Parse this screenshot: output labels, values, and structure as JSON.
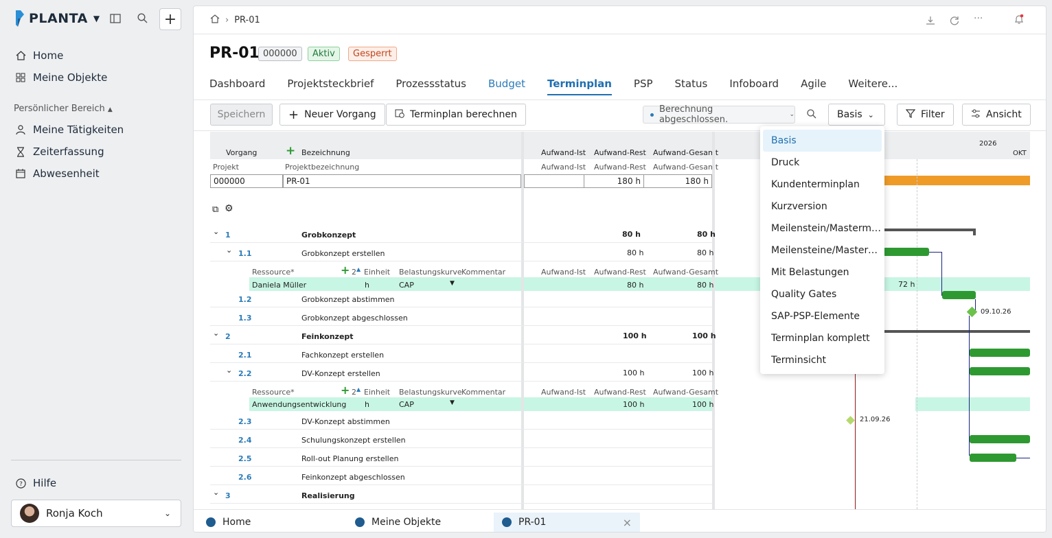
{
  "sidebar": {
    "logo": "PLANTA",
    "nav": [
      {
        "label": "Home",
        "icon": "home-icon"
      },
      {
        "label": "Meine Objekte",
        "icon": "grid-icon"
      }
    ],
    "section_title": "Persönlicher Bereich",
    "personal": [
      {
        "label": "Meine Tätigkeiten",
        "icon": "person-icon"
      },
      {
        "label": "Zeiterfassung",
        "icon": "hourglass-icon"
      },
      {
        "label": "Abwesenheit",
        "icon": "calendar-icon"
      }
    ],
    "help": "Hilfe",
    "user": "Ronja Koch"
  },
  "breadcrumb": "PR-01",
  "project": {
    "title": "PR-01",
    "id_badge": "000000",
    "status_active": "Aktiv",
    "status_locked": "Gesperrt"
  },
  "tabs": [
    "Dashboard",
    "Projektsteckbrief",
    "Prozessstatus",
    "Budget",
    "Terminplan",
    "PSP",
    "Status",
    "Infoboard",
    "Agile",
    "Weitere..."
  ],
  "toolbar": {
    "save": "Speichern",
    "new_task": "Neuer Vorgang",
    "calc": "Terminplan berechnen",
    "status": "Berechnung abgeschlossen.",
    "view_select": "Basis",
    "filter": "Filter",
    "view": "Ansicht"
  },
  "grid": {
    "headers": {
      "vorgang": "Vorgang",
      "bezeichnung": "Bezeichnung",
      "ist": "Aufwand-Ist",
      "rest": "Aufwand-Rest",
      "gesamt": "Aufwand-Gesamt"
    },
    "sub_headers": {
      "projekt": "Projekt",
      "projektbez": "Projektbezeichnung",
      "ist": "Aufwand-Ist",
      "rest": "Aufwand-Rest",
      "gesamt": "Aufwand-Gesamt"
    },
    "project_row": {
      "id": "000000",
      "name": "PR-01",
      "rest": "180 h",
      "gesamt": "180 h"
    },
    "res_headers": {
      "ressource": "Ressource*",
      "count": "2",
      "einheit": "Einheit",
      "kurve": "Belastungskurve",
      "kommentar": "Kommentar",
      "ist": "Aufwand-Ist",
      "rest": "Aufwand-Rest",
      "gesamt": "Aufwand-Gesamt"
    },
    "rows": [
      {
        "no": "1",
        "name": "Grobkonzept",
        "rest": "80 h",
        "gesamt": "80 h",
        "level": 0,
        "bold": true
      },
      {
        "no": "1.1",
        "name": "Grobkonzept erstellen",
        "rest": "80 h",
        "gesamt": "80 h",
        "level": 1,
        "bold": false
      },
      {
        "res": "Daniela Müller",
        "einheit": "h",
        "kurve": "CAP",
        "rest": "80 h",
        "gesamt": "80 h"
      },
      {
        "no": "1.2",
        "name": "Grobkonzept abstimmen",
        "rest": "",
        "gesamt": "",
        "level": 1,
        "bold": false
      },
      {
        "no": "1.3",
        "name": "Grobkonzept abgeschlossen",
        "rest": "",
        "gesamt": "",
        "level": 1,
        "bold": false
      },
      {
        "no": "2",
        "name": "Feinkonzept",
        "rest": "100 h",
        "gesamt": "100 h",
        "level": 0,
        "bold": true
      },
      {
        "no": "2.1",
        "name": "Fachkonzept erstellen",
        "rest": "",
        "gesamt": "",
        "level": 1,
        "bold": false
      },
      {
        "no": "2.2",
        "name": "DV-Konzept erstellen",
        "rest": "100 h",
        "gesamt": "100 h",
        "level": 1,
        "bold": false
      },
      {
        "res": "Anwendungsentwicklung",
        "einheit": "h",
        "kurve": "CAP",
        "rest": "100 h",
        "gesamt": "100 h"
      },
      {
        "no": "2.3",
        "name": "DV-Konzept abstimmen",
        "rest": "",
        "gesamt": "",
        "level": 1,
        "bold": false
      },
      {
        "no": "2.4",
        "name": "Schulungskonzept erstellen",
        "rest": "",
        "gesamt": "",
        "level": 1,
        "bold": false
      },
      {
        "no": "2.5",
        "name": "Roll-out Planung erstellen",
        "rest": "",
        "gesamt": "",
        "level": 1,
        "bold": false
      },
      {
        "no": "2.6",
        "name": "Feinkonzept abgeschlossen",
        "rest": "",
        "gesamt": "",
        "level": 1,
        "bold": false
      },
      {
        "no": "3",
        "name": "Realisierung",
        "rest": "",
        "gesamt": "",
        "level": 0,
        "bold": true
      }
    ]
  },
  "gantt": {
    "year": "2026",
    "month": "OKT",
    "label_72h": "72 h",
    "milestone1": "09.10.26",
    "milestone2": "21.09.26"
  },
  "dropdown": [
    "Basis",
    "Druck",
    "Kundenterminplan",
    "Kurzversion",
    "Meilenstein/Masterme...",
    "Meilensteine/Masterm...",
    "Mit Belastungen",
    "Quality Gates",
    "SAP-PSP-Elemente",
    "Terminplan komplett",
    "Terminsicht"
  ],
  "bottom_tabs": [
    "Home",
    "Meine Objekte",
    "PR-01"
  ],
  "colors": {
    "accent": "#1f6fb0",
    "green": "#2e9931",
    "orange": "#ef9b28",
    "resource_bg": "#c8f6e4"
  }
}
